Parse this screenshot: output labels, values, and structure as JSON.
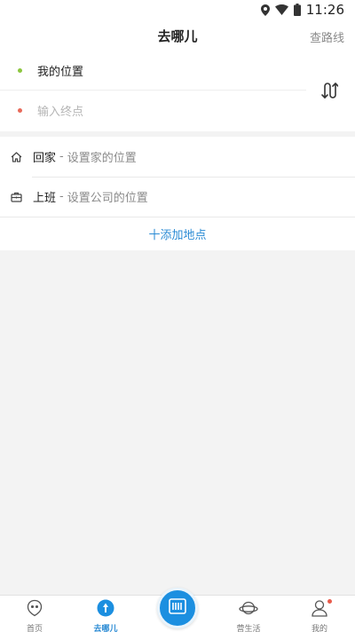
{
  "status_bar": {
    "time": "11:26"
  },
  "header": {
    "title": "去哪儿",
    "route_link": "查路线"
  },
  "route": {
    "start_label": "我的位置",
    "end_placeholder": "输入终点",
    "start_dot_color": "#8cc63f",
    "end_dot_color": "#e86a5a"
  },
  "places": {
    "home": {
      "name": "回家",
      "separator": "-",
      "hint": "设置家的位置"
    },
    "work": {
      "name": "上班",
      "separator": "-",
      "hint": "设置公司的位置"
    },
    "add_label": "十添加地点"
  },
  "tabbar": {
    "tabs": [
      {
        "label": "首页",
        "icon": "home-face-icon"
      },
      {
        "label": "去哪儿",
        "icon": "navigation-icon"
      },
      {
        "label": "营生活",
        "icon": "planet-icon"
      },
      {
        "label": "我的",
        "icon": "user-icon"
      }
    ],
    "center_icon": "scan-icon",
    "accent": "#2b8bd4"
  }
}
